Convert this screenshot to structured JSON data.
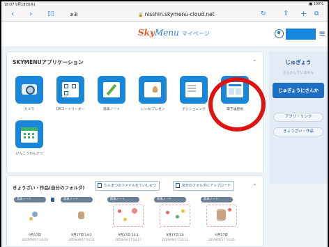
{
  "status": {
    "time": "18:07  9月18日(水)",
    "battery": "■ 100%"
  },
  "browser": {
    "aa": "ぁあ",
    "url": "nisshin.skymenu-cloud.net",
    "icons": [
      "chevron-left-icon",
      "chevron-right-icon",
      "book-icon",
      "reload-icon",
      "share-icon",
      "plus-icon",
      "tabs-icon"
    ]
  },
  "header": {
    "logo_sky": "Sky",
    "logo_menu": "Menu",
    "mypage": "マイページ"
  },
  "apps": {
    "title": "SKYMENUアプリケーション",
    "items": [
      {
        "label": "カメラ",
        "icon": "camera-icon"
      },
      {
        "label": "QRコードリーダー",
        "icon": "qr-code-icon"
      },
      {
        "label": "発表ノート",
        "icon": "note-pen-icon"
      },
      {
        "label": "シンカ/プレゼン",
        "icon": "presentation-icon"
      },
      {
        "label": "ポジショニング",
        "icon": "board-icon"
      },
      {
        "label": "電子連絡帳",
        "icon": "window-icon"
      },
      {
        "label": "けんこうかんさつ",
        "icon": "calendar-check-icon"
      }
    ]
  },
  "side": {
    "title": "じゅぎょう",
    "subtitle": "さんかしていません",
    "join": "じゅぎょうにさんか",
    "link1": "アプリ・リンク",
    "link2": "きょうざい・作品"
  },
  "works": {
    "title": "きょうざい・作品(自分のフォルダ)",
    "btn_share": "たんまつのファイルをていしゅつ",
    "btn_upload": "自分のフォルダにアップロード",
    "cards": [
      {
        "tag": "発表ノート",
        "date": "9月17日",
        "sub": "2019/09/17 10:03"
      },
      {
        "tag": "発表ノート",
        "date": "9月17日 14:2",
        "sub": "2019/09/17 14:24"
      },
      {
        "tag": "発表ノート",
        "date": "9月17日 10:1",
        "sub": "2019/09/17 10:17"
      },
      {
        "tag": "発表ノート",
        "date": "9月17日 10",
        "sub": "2019/09/17 10:12"
      },
      {
        "tag": "発表ノート",
        "date": "9月17日",
        "sub": "2019/09/17 10:05"
      }
    ]
  },
  "colors": {
    "accent": "#1a86d9",
    "highlight": "#e01313",
    "join_button": "#1f6fc4"
  }
}
